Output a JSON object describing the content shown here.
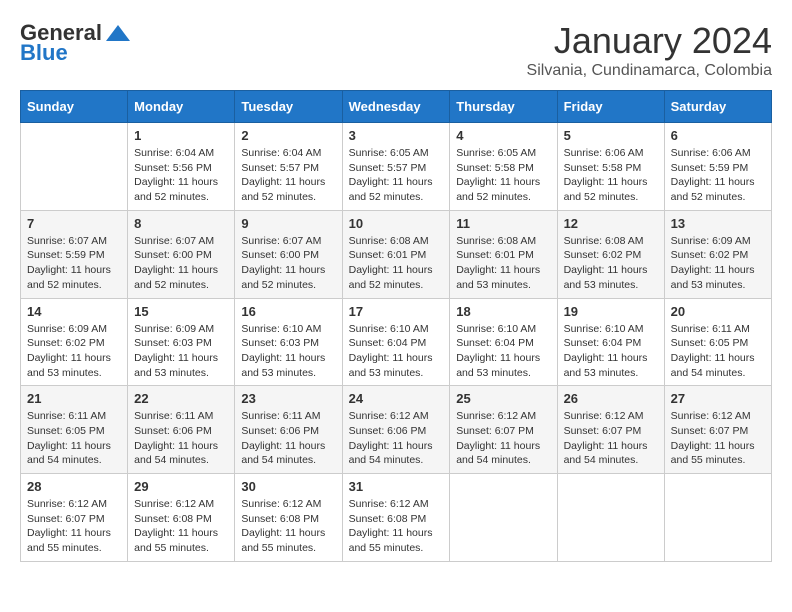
{
  "header": {
    "logo": {
      "general": "General",
      "blue": "Blue"
    },
    "title": "January 2024",
    "subtitle": "Silvania, Cundinamarca, Colombia"
  },
  "calendar": {
    "days_of_week": [
      "Sunday",
      "Monday",
      "Tuesday",
      "Wednesday",
      "Thursday",
      "Friday",
      "Saturday"
    ],
    "weeks": [
      [
        {
          "day": "",
          "sunrise": "",
          "sunset": "",
          "daylight": ""
        },
        {
          "day": "1",
          "sunrise": "Sunrise: 6:04 AM",
          "sunset": "Sunset: 5:56 PM",
          "daylight": "Daylight: 11 hours and 52 minutes."
        },
        {
          "day": "2",
          "sunrise": "Sunrise: 6:04 AM",
          "sunset": "Sunset: 5:57 PM",
          "daylight": "Daylight: 11 hours and 52 minutes."
        },
        {
          "day": "3",
          "sunrise": "Sunrise: 6:05 AM",
          "sunset": "Sunset: 5:57 PM",
          "daylight": "Daylight: 11 hours and 52 minutes."
        },
        {
          "day": "4",
          "sunrise": "Sunrise: 6:05 AM",
          "sunset": "Sunset: 5:58 PM",
          "daylight": "Daylight: 11 hours and 52 minutes."
        },
        {
          "day": "5",
          "sunrise": "Sunrise: 6:06 AM",
          "sunset": "Sunset: 5:58 PM",
          "daylight": "Daylight: 11 hours and 52 minutes."
        },
        {
          "day": "6",
          "sunrise": "Sunrise: 6:06 AM",
          "sunset": "Sunset: 5:59 PM",
          "daylight": "Daylight: 11 hours and 52 minutes."
        }
      ],
      [
        {
          "day": "7",
          "sunrise": "Sunrise: 6:07 AM",
          "sunset": "Sunset: 5:59 PM",
          "daylight": "Daylight: 11 hours and 52 minutes."
        },
        {
          "day": "8",
          "sunrise": "Sunrise: 6:07 AM",
          "sunset": "Sunset: 6:00 PM",
          "daylight": "Daylight: 11 hours and 52 minutes."
        },
        {
          "day": "9",
          "sunrise": "Sunrise: 6:07 AM",
          "sunset": "Sunset: 6:00 PM",
          "daylight": "Daylight: 11 hours and 52 minutes."
        },
        {
          "day": "10",
          "sunrise": "Sunrise: 6:08 AM",
          "sunset": "Sunset: 6:01 PM",
          "daylight": "Daylight: 11 hours and 52 minutes."
        },
        {
          "day": "11",
          "sunrise": "Sunrise: 6:08 AM",
          "sunset": "Sunset: 6:01 PM",
          "daylight": "Daylight: 11 hours and 53 minutes."
        },
        {
          "day": "12",
          "sunrise": "Sunrise: 6:08 AM",
          "sunset": "Sunset: 6:02 PM",
          "daylight": "Daylight: 11 hours and 53 minutes."
        },
        {
          "day": "13",
          "sunrise": "Sunrise: 6:09 AM",
          "sunset": "Sunset: 6:02 PM",
          "daylight": "Daylight: 11 hours and 53 minutes."
        }
      ],
      [
        {
          "day": "14",
          "sunrise": "Sunrise: 6:09 AM",
          "sunset": "Sunset: 6:02 PM",
          "daylight": "Daylight: 11 hours and 53 minutes."
        },
        {
          "day": "15",
          "sunrise": "Sunrise: 6:09 AM",
          "sunset": "Sunset: 6:03 PM",
          "daylight": "Daylight: 11 hours and 53 minutes."
        },
        {
          "day": "16",
          "sunrise": "Sunrise: 6:10 AM",
          "sunset": "Sunset: 6:03 PM",
          "daylight": "Daylight: 11 hours and 53 minutes."
        },
        {
          "day": "17",
          "sunrise": "Sunrise: 6:10 AM",
          "sunset": "Sunset: 6:04 PM",
          "daylight": "Daylight: 11 hours and 53 minutes."
        },
        {
          "day": "18",
          "sunrise": "Sunrise: 6:10 AM",
          "sunset": "Sunset: 6:04 PM",
          "daylight": "Daylight: 11 hours and 53 minutes."
        },
        {
          "day": "19",
          "sunrise": "Sunrise: 6:10 AM",
          "sunset": "Sunset: 6:04 PM",
          "daylight": "Daylight: 11 hours and 53 minutes."
        },
        {
          "day": "20",
          "sunrise": "Sunrise: 6:11 AM",
          "sunset": "Sunset: 6:05 PM",
          "daylight": "Daylight: 11 hours and 54 minutes."
        }
      ],
      [
        {
          "day": "21",
          "sunrise": "Sunrise: 6:11 AM",
          "sunset": "Sunset: 6:05 PM",
          "daylight": "Daylight: 11 hours and 54 minutes."
        },
        {
          "day": "22",
          "sunrise": "Sunrise: 6:11 AM",
          "sunset": "Sunset: 6:06 PM",
          "daylight": "Daylight: 11 hours and 54 minutes."
        },
        {
          "day": "23",
          "sunrise": "Sunrise: 6:11 AM",
          "sunset": "Sunset: 6:06 PM",
          "daylight": "Daylight: 11 hours and 54 minutes."
        },
        {
          "day": "24",
          "sunrise": "Sunrise: 6:12 AM",
          "sunset": "Sunset: 6:06 PM",
          "daylight": "Daylight: 11 hours and 54 minutes."
        },
        {
          "day": "25",
          "sunrise": "Sunrise: 6:12 AM",
          "sunset": "Sunset: 6:07 PM",
          "daylight": "Daylight: 11 hours and 54 minutes."
        },
        {
          "day": "26",
          "sunrise": "Sunrise: 6:12 AM",
          "sunset": "Sunset: 6:07 PM",
          "daylight": "Daylight: 11 hours and 54 minutes."
        },
        {
          "day": "27",
          "sunrise": "Sunrise: 6:12 AM",
          "sunset": "Sunset: 6:07 PM",
          "daylight": "Daylight: 11 hours and 55 minutes."
        }
      ],
      [
        {
          "day": "28",
          "sunrise": "Sunrise: 6:12 AM",
          "sunset": "Sunset: 6:07 PM",
          "daylight": "Daylight: 11 hours and 55 minutes."
        },
        {
          "day": "29",
          "sunrise": "Sunrise: 6:12 AM",
          "sunset": "Sunset: 6:08 PM",
          "daylight": "Daylight: 11 hours and 55 minutes."
        },
        {
          "day": "30",
          "sunrise": "Sunrise: 6:12 AM",
          "sunset": "Sunset: 6:08 PM",
          "daylight": "Daylight: 11 hours and 55 minutes."
        },
        {
          "day": "31",
          "sunrise": "Sunrise: 6:12 AM",
          "sunset": "Sunset: 6:08 PM",
          "daylight": "Daylight: 11 hours and 55 minutes."
        },
        {
          "day": "",
          "sunrise": "",
          "sunset": "",
          "daylight": ""
        },
        {
          "day": "",
          "sunrise": "",
          "sunset": "",
          "daylight": ""
        },
        {
          "day": "",
          "sunrise": "",
          "sunset": "",
          "daylight": ""
        }
      ]
    ]
  }
}
